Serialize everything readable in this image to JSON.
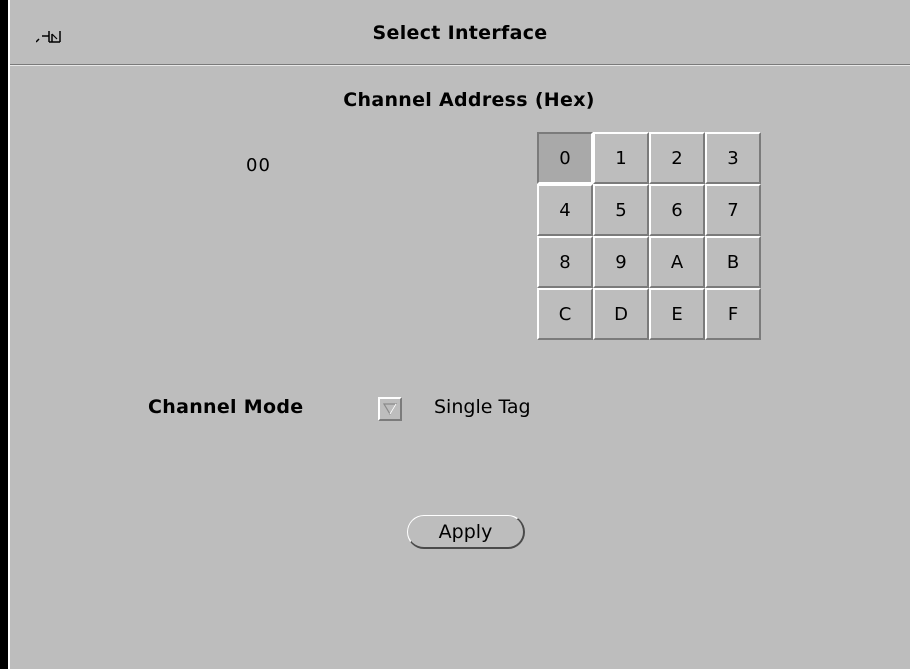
{
  "window": {
    "title": "Select Interface",
    "pin_icon": "pushpin-icon"
  },
  "channel_address": {
    "heading": "Channel Address (Hex)",
    "value": "00",
    "keys": [
      "0",
      "1",
      "2",
      "3",
      "4",
      "5",
      "6",
      "7",
      "8",
      "9",
      "A",
      "B",
      "C",
      "D",
      "E",
      "F"
    ],
    "selected_key": "0"
  },
  "channel_mode": {
    "label": "Channel Mode",
    "menu_icon": "triangle-down-icon",
    "value": "Single Tag"
  },
  "actions": {
    "apply_label": "Apply"
  }
}
